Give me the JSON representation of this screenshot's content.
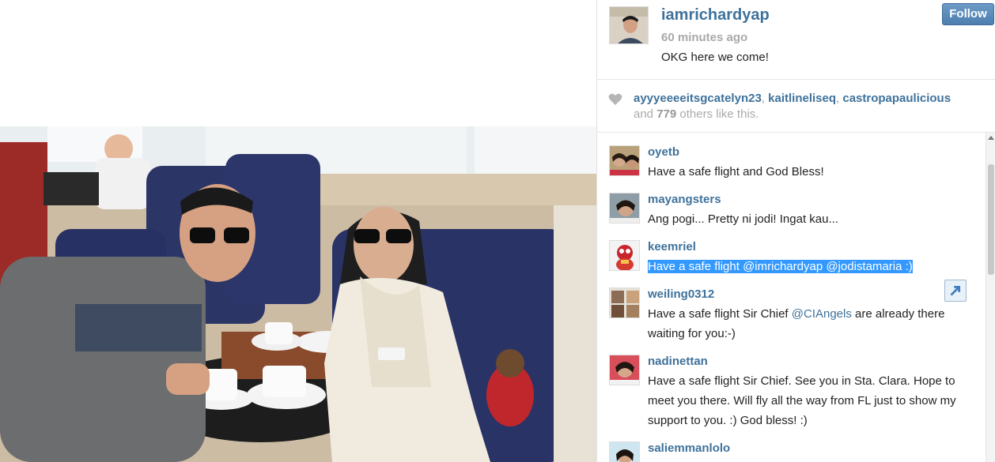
{
  "post": {
    "username": "iamrichardyap",
    "time": "60 minutes ago",
    "caption": "OKG here we come!",
    "follow_label": "Follow"
  },
  "likes": {
    "likers": [
      "ayyyeeeeitsgcatelyn23",
      "kaitlineliseq",
      "castropapaulicious"
    ],
    "sep1": ", ",
    "sep2": ", ",
    "and_text": "and ",
    "others_count": "779",
    "others_text": " others like this."
  },
  "comments": [
    {
      "user": "oyetb",
      "text": "Have a safe flight and God Bless!"
    },
    {
      "user": "mayangsters",
      "text": "Ang pogi... Pretty ni jodi! Ingat kau..."
    },
    {
      "user": "keemriel",
      "text": "Have a safe flight @imrichardyap @jodistamaria :)"
    },
    {
      "user": "weiling0312",
      "text_pre": "Have a safe flight Sir Chief ",
      "mention": "@CIAngels",
      "text_post": " are already there waiting for you:-)"
    },
    {
      "user": "nadinettan",
      "text": "Have a safe flight Sir Chief. See you in Sta. Clara. Hope to meet you there. Will fly all the way from FL just to show my support to you. :) God bless! :)"
    },
    {
      "user": "saliemmanlolo",
      "text": ""
    }
  ],
  "icons": {
    "heart": "heart-icon",
    "expand": "expand-icon",
    "scroll_up": "scroll-up-arrow-icon"
  },
  "colors": {
    "username": "#3f729b",
    "follow_button": "#5b8ec0",
    "highlight": "#3399ff"
  }
}
